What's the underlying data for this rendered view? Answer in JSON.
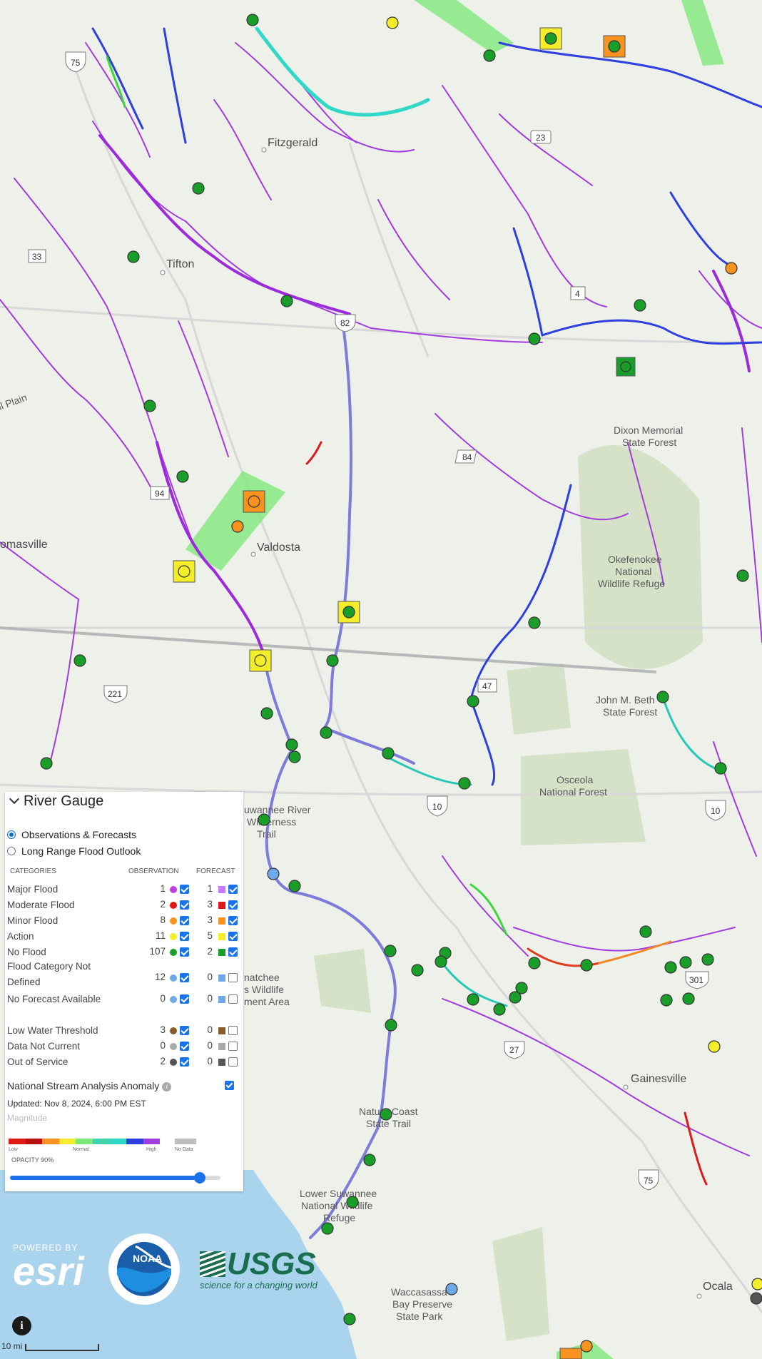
{
  "places": {
    "fitzgerald": "Fitzgerald",
    "tifton": "Tifton",
    "valdosta": "Valdosta",
    "thomasville": "omasville",
    "plains": "ll Plain",
    "dixon": [
      "Dixon Memorial",
      "State Forest"
    ],
    "okefenokee": [
      "Okefenokee",
      "National",
      "Wildlife Refuge"
    ],
    "john_bethea": [
      "John M. Beth",
      "State Forest"
    ],
    "osceola": [
      "Osceola",
      "National Forest"
    ],
    "suwannee_trail": [
      "uwannee River",
      "Wilderness",
      "Trail"
    ],
    "twin_rivers": [
      "natchee",
      "s Wildlife",
      "ment Area"
    ],
    "nature_coast": [
      "Nature Coast",
      "State Trail"
    ],
    "lower_suwannee": [
      "Lower Suwannee",
      "National Wildlife",
      "Refuge"
    ],
    "waccasassa": [
      "Waccasassa",
      "Bay Preserve",
      "State Park"
    ],
    "gainesville": "Gainesville",
    "ocala": "Ocala"
  },
  "shields": {
    "i75_top": "75",
    "us23": "23",
    "s33": "33",
    "s4": "4",
    "us82": "82",
    "s84": "84",
    "s94": "94",
    "s47": "47",
    "us221": "221",
    "i10_a": "10",
    "i10_b": "10",
    "us301": "301",
    "us27": "27",
    "i75_bot": "75"
  },
  "legend": {
    "title": "River Gauge",
    "radio_observations": "Observations & Forecasts",
    "radio_long_range": "Long Range Flood Outlook",
    "col_categories": "CATEGORIES",
    "col_observation": "OBSERVATION",
    "col_forecast": "FORECAST",
    "rows": [
      {
        "name": "Major Flood",
        "obs": "1",
        "obs_color": "#c13ee0",
        "fc": "1",
        "fc_color": "#c77aff",
        "obs_checked": true,
        "fc_checked": true
      },
      {
        "name": "Moderate Flood",
        "obs": "2",
        "obs_color": "#e01818",
        "fc": "3",
        "fc_color": "#e01818",
        "obs_checked": true,
        "fc_checked": true
      },
      {
        "name": "Minor Flood",
        "obs": "8",
        "obs_color": "#f7931e",
        "fc": "3",
        "fc_color": "#f7931e",
        "obs_checked": true,
        "fc_checked": true
      },
      {
        "name": "Action",
        "obs": "11",
        "obs_color": "#f4ed2a",
        "fc": "5",
        "fc_color": "#f4ed2a",
        "obs_checked": true,
        "fc_checked": true
      },
      {
        "name": "No Flood",
        "obs": "107",
        "obs_color": "#1a9e2a",
        "fc": "2",
        "fc_color": "#1a9e2a",
        "obs_checked": true,
        "fc_checked": true
      },
      {
        "name": "Flood Category Not Defined",
        "obs": "12",
        "obs_color": "#6fa8e6",
        "fc": "0",
        "fc_color": "#6fa8e6",
        "obs_checked": true,
        "fc_checked": false
      },
      {
        "name": "No Forecast Available",
        "obs": "0",
        "obs_color": "#6fa8e6",
        "fc": "0",
        "fc_color": "#6fa8e6",
        "obs_checked": true,
        "fc_checked": false
      },
      {
        "name": "Low Water Threshold",
        "obs": "3",
        "obs_color": "#8b5a2b",
        "fc": "0",
        "fc_color": "#8b5a2b",
        "obs_checked": true,
        "fc_checked": false
      },
      {
        "name": "Data Not Current",
        "obs": "0",
        "obs_color": "#aaaaaa",
        "fc": "0",
        "fc_color": "#aaaaaa",
        "obs_checked": true,
        "fc_checked": false
      },
      {
        "name": "Out of Service",
        "obs": "2",
        "obs_color": "#555555",
        "fc": "0",
        "fc_color": "#555555",
        "obs_checked": true,
        "fc_checked": false
      }
    ],
    "nsa_label": "National Stream Analysis Anomaly",
    "updated": "Updated: Nov 8, 2024, 6:00 PM EST",
    "magnitude": "Magnitude",
    "ramp_low": "Low",
    "ramp_normal": "Normal",
    "ramp_high": "High",
    "ramp_nodata": "No Data",
    "opacity": "OPACITY 90%",
    "opacity_value": 0.9
  },
  "logos": {
    "esri_powered": "POWERED BY",
    "esri": "esri",
    "noaa": "NOAA",
    "usgs": "USGS",
    "usgs_tag": "science for a changing world"
  },
  "scale": "10 mi"
}
